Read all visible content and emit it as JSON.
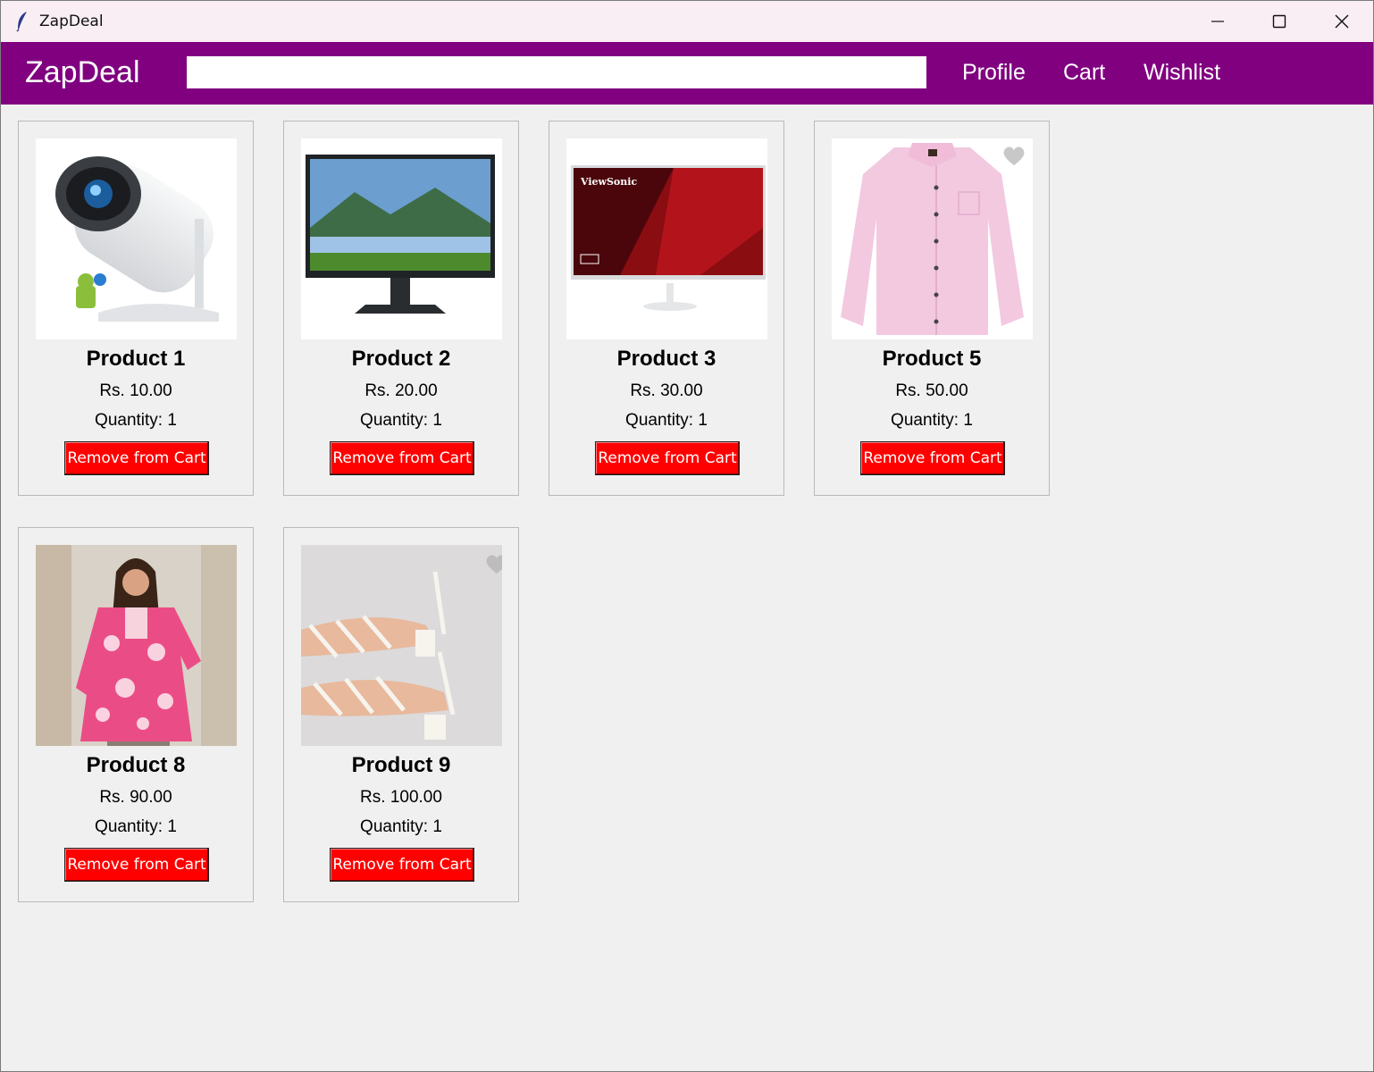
{
  "window": {
    "title": "ZapDeal"
  },
  "navbar": {
    "brand": "ZapDeal",
    "search_value": "",
    "links": {
      "profile": "Profile",
      "cart": "Cart",
      "wishlist": "Wishlist"
    },
    "background": "#800080"
  },
  "products": [
    {
      "name": "Product 1",
      "price": "Rs. 10.00",
      "quantity": "Quantity: 1",
      "button": "Remove from Cart",
      "image": "projector"
    },
    {
      "name": "Product 2",
      "price": "Rs. 20.00",
      "quantity": "Quantity: 1",
      "button": "Remove from Cart",
      "image": "monitor-landscape"
    },
    {
      "name": "Product 3",
      "price": "Rs. 30.00",
      "quantity": "Quantity: 1",
      "button": "Remove from Cart",
      "image": "monitor-viewsonic",
      "brand_text": "ViewSonic"
    },
    {
      "name": "Product 5",
      "price": "Rs. 50.00",
      "quantity": "Quantity: 1",
      "button": "Remove from Cart",
      "image": "pink-shirt"
    },
    {
      "name": "Product 8",
      "price": "Rs. 90.00",
      "quantity": "Quantity: 1",
      "button": "Remove from Cart",
      "image": "pink-kurta"
    },
    {
      "name": "Product 9",
      "price": "Rs. 100.00",
      "quantity": "Quantity: 1",
      "button": "Remove from Cart",
      "image": "white-heels"
    }
  ],
  "colors": {
    "remove_button": "#ff0000",
    "page_bg": "#f0f0f0"
  }
}
